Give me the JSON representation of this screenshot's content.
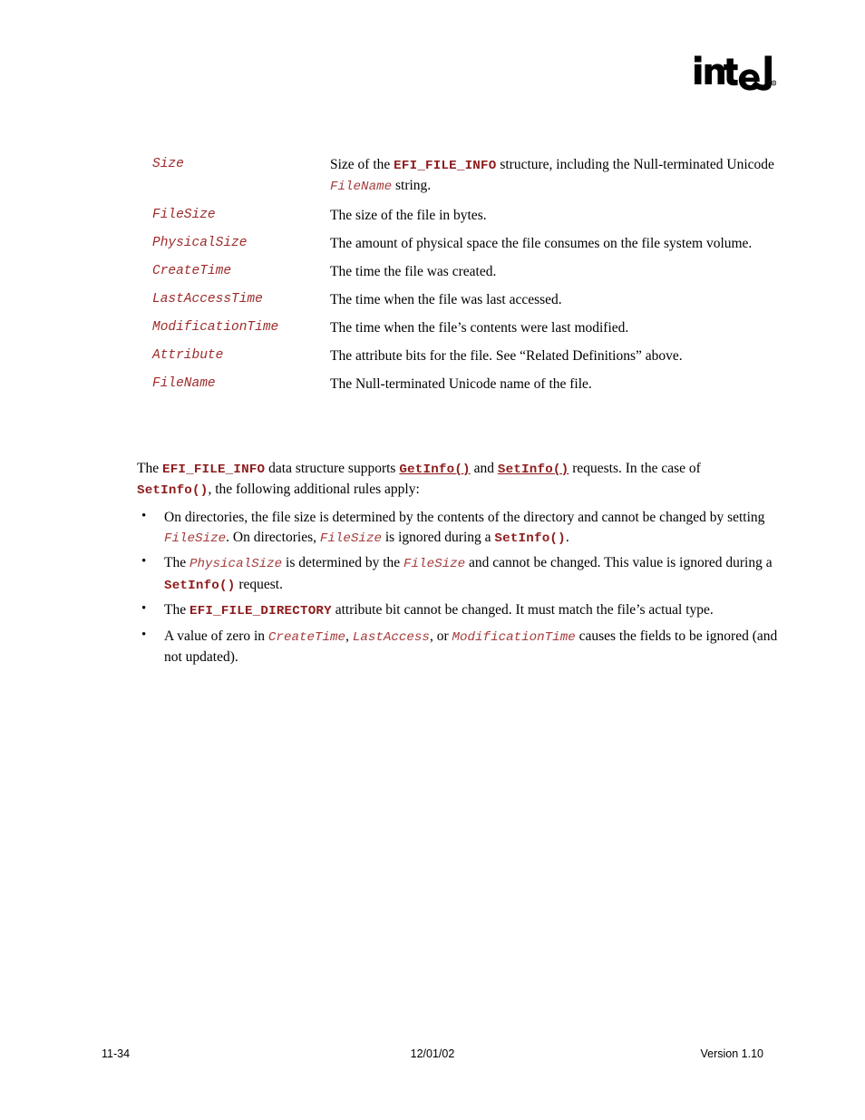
{
  "logo": {
    "name": "intel-logo",
    "wordmark": "intel",
    "registered_mark": "®"
  },
  "definitions": [
    {
      "term": "Size",
      "desc_parts": [
        {
          "type": "text",
          "value": "Size of the "
        },
        {
          "type": "mono-bold",
          "value": "EFI_FILE_INFO"
        },
        {
          "type": "text",
          "value": " structure, including the Null-terminated Unicode "
        },
        {
          "type": "mono-italic",
          "value": "FileName"
        },
        {
          "type": "text",
          "value": " string."
        }
      ]
    },
    {
      "term": "FileSize",
      "desc_parts": [
        {
          "type": "text",
          "value": "The size of the file in bytes."
        }
      ]
    },
    {
      "term": "PhysicalSize",
      "desc_parts": [
        {
          "type": "text",
          "value": "The amount of physical space the file consumes on the file system volume."
        }
      ]
    },
    {
      "term": "CreateTime",
      "desc_parts": [
        {
          "type": "text",
          "value": "The time the file was created."
        }
      ]
    },
    {
      "term": "LastAccessTime",
      "desc_parts": [
        {
          "type": "text",
          "value": "The time when the file was last accessed."
        }
      ]
    },
    {
      "term": "ModificationTime",
      "desc_parts": [
        {
          "type": "text",
          "value": "The time when the file’s contents were last modified."
        }
      ]
    },
    {
      "term": "Attribute",
      "desc_parts": [
        {
          "type": "text",
          "value": "The attribute bits for the file.  See “Related Definitions” above."
        }
      ]
    },
    {
      "term": "FileName",
      "desc_parts": [
        {
          "type": "text",
          "value": "The Null-terminated Unicode name of the file."
        }
      ]
    }
  ],
  "paragraph": {
    "parts": [
      {
        "type": "text",
        "value": "The "
      },
      {
        "type": "mono-bold",
        "value": "EFI_FILE_INFO"
      },
      {
        "type": "text",
        "value": " data structure supports "
      },
      {
        "type": "mono-bold-link",
        "value": "GetInfo()"
      },
      {
        "type": "text",
        "value": " and "
      },
      {
        "type": "mono-bold-link",
        "value": "SetInfo()"
      },
      {
        "type": "text",
        "value": " requests.  In the case of "
      },
      {
        "type": "mono-bold",
        "value": "SetInfo()"
      },
      {
        "type": "text",
        "value": ", the following additional rules apply:"
      }
    ]
  },
  "bullet_glyph": "•",
  "rules": [
    {
      "parts": [
        {
          "type": "text",
          "value": "On directories, the file size is determined by the contents of the directory and cannot be changed by setting "
        },
        {
          "type": "mono-italic",
          "value": "FileSize"
        },
        {
          "type": "text",
          "value": ".  On directories, "
        },
        {
          "type": "mono-italic",
          "value": "FileSize"
        },
        {
          "type": "text",
          "value": " is ignored during a "
        },
        {
          "type": "mono-bold",
          "value": "SetInfo()"
        },
        {
          "type": "text",
          "value": "."
        }
      ]
    },
    {
      "parts": [
        {
          "type": "text",
          "value": "The "
        },
        {
          "type": "mono-italic",
          "value": "PhysicalSize"
        },
        {
          "type": "text",
          "value": " is determined by the "
        },
        {
          "type": "mono-italic",
          "value": "FileSize"
        },
        {
          "type": "text",
          "value": " and cannot be changed.  This value is ignored during a "
        },
        {
          "type": "mono-bold",
          "value": "SetInfo()"
        },
        {
          "type": "text",
          "value": " request."
        }
      ]
    },
    {
      "parts": [
        {
          "type": "text",
          "value": "The "
        },
        {
          "type": "mono-bold",
          "value": "EFI_FILE_DIRECTORY"
        },
        {
          "type": "text",
          "value": " attribute bit cannot be changed.  It must match the file’s actual type."
        }
      ]
    },
    {
      "parts": [
        {
          "type": "text",
          "value": "A value of zero in "
        },
        {
          "type": "mono-italic",
          "value": "CreateTime"
        },
        {
          "type": "text",
          "value": ", "
        },
        {
          "type": "mono-italic",
          "value": "LastAccess"
        },
        {
          "type": "text",
          "value": ", or "
        },
        {
          "type": "mono-italic",
          "value": "ModificationTime"
        },
        {
          "type": "text",
          "value": " causes the fields to be ignored (and not updated)."
        }
      ]
    }
  ],
  "footer": {
    "page_number": "11-34",
    "date": "12/01/02",
    "version": "Version 1.10"
  },
  "colors": {
    "code_bold": "#8E1B1B",
    "code_italic": "#A63B3B",
    "text": "#000000",
    "background": "#FFFFFF"
  }
}
